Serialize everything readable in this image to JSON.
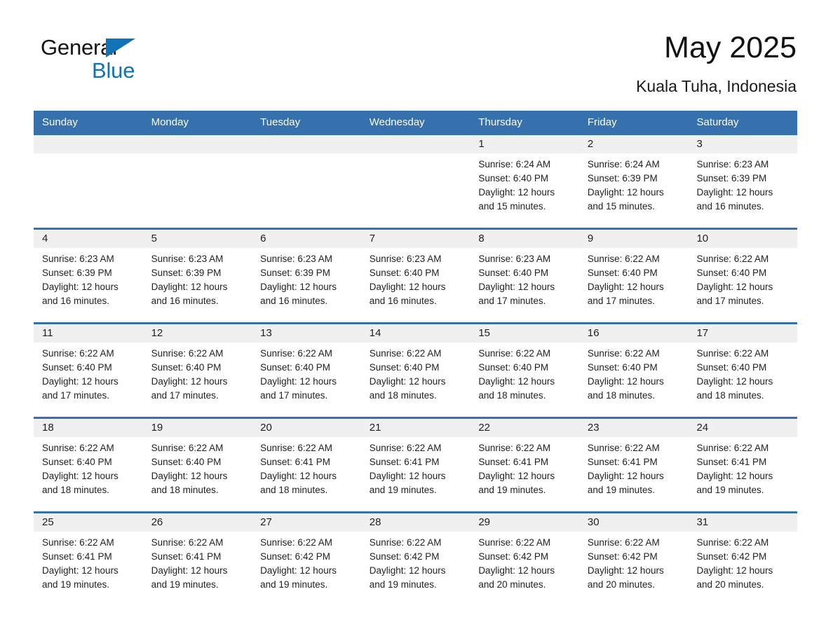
{
  "brand": {
    "name_part1": "General",
    "name_part2": "Blue",
    "triangle_color": "#1272b6"
  },
  "header": {
    "title": "May 2025",
    "subtitle": "Kuala Tuha, Indonesia"
  },
  "colors": {
    "header_blue": "#3771ad",
    "day_band_gray": "#f0f0f0",
    "brand_blue": "#1272b6"
  },
  "calendar": {
    "weekday_headers": [
      "Sunday",
      "Monday",
      "Tuesday",
      "Wednesday",
      "Thursday",
      "Friday",
      "Saturday"
    ],
    "weeks": [
      [
        {
          "day": "",
          "sunrise": "",
          "sunset": "",
          "daylight_line1": "",
          "daylight_line2": ""
        },
        {
          "day": "",
          "sunrise": "",
          "sunset": "",
          "daylight_line1": "",
          "daylight_line2": ""
        },
        {
          "day": "",
          "sunrise": "",
          "sunset": "",
          "daylight_line1": "",
          "daylight_line2": ""
        },
        {
          "day": "",
          "sunrise": "",
          "sunset": "",
          "daylight_line1": "",
          "daylight_line2": ""
        },
        {
          "day": "1",
          "sunrise": "Sunrise: 6:24 AM",
          "sunset": "Sunset: 6:40 PM",
          "daylight_line1": "Daylight: 12 hours",
          "daylight_line2": "and 15 minutes."
        },
        {
          "day": "2",
          "sunrise": "Sunrise: 6:24 AM",
          "sunset": "Sunset: 6:39 PM",
          "daylight_line1": "Daylight: 12 hours",
          "daylight_line2": "and 15 minutes."
        },
        {
          "day": "3",
          "sunrise": "Sunrise: 6:23 AM",
          "sunset": "Sunset: 6:39 PM",
          "daylight_line1": "Daylight: 12 hours",
          "daylight_line2": "and 16 minutes."
        }
      ],
      [
        {
          "day": "4",
          "sunrise": "Sunrise: 6:23 AM",
          "sunset": "Sunset: 6:39 PM",
          "daylight_line1": "Daylight: 12 hours",
          "daylight_line2": "and 16 minutes."
        },
        {
          "day": "5",
          "sunrise": "Sunrise: 6:23 AM",
          "sunset": "Sunset: 6:39 PM",
          "daylight_line1": "Daylight: 12 hours",
          "daylight_line2": "and 16 minutes."
        },
        {
          "day": "6",
          "sunrise": "Sunrise: 6:23 AM",
          "sunset": "Sunset: 6:39 PM",
          "daylight_line1": "Daylight: 12 hours",
          "daylight_line2": "and 16 minutes."
        },
        {
          "day": "7",
          "sunrise": "Sunrise: 6:23 AM",
          "sunset": "Sunset: 6:40 PM",
          "daylight_line1": "Daylight: 12 hours",
          "daylight_line2": "and 16 minutes."
        },
        {
          "day": "8",
          "sunrise": "Sunrise: 6:23 AM",
          "sunset": "Sunset: 6:40 PM",
          "daylight_line1": "Daylight: 12 hours",
          "daylight_line2": "and 17 minutes."
        },
        {
          "day": "9",
          "sunrise": "Sunrise: 6:22 AM",
          "sunset": "Sunset: 6:40 PM",
          "daylight_line1": "Daylight: 12 hours",
          "daylight_line2": "and 17 minutes."
        },
        {
          "day": "10",
          "sunrise": "Sunrise: 6:22 AM",
          "sunset": "Sunset: 6:40 PM",
          "daylight_line1": "Daylight: 12 hours",
          "daylight_line2": "and 17 minutes."
        }
      ],
      [
        {
          "day": "11",
          "sunrise": "Sunrise: 6:22 AM",
          "sunset": "Sunset: 6:40 PM",
          "daylight_line1": "Daylight: 12 hours",
          "daylight_line2": "and 17 minutes."
        },
        {
          "day": "12",
          "sunrise": "Sunrise: 6:22 AM",
          "sunset": "Sunset: 6:40 PM",
          "daylight_line1": "Daylight: 12 hours",
          "daylight_line2": "and 17 minutes."
        },
        {
          "day": "13",
          "sunrise": "Sunrise: 6:22 AM",
          "sunset": "Sunset: 6:40 PM",
          "daylight_line1": "Daylight: 12 hours",
          "daylight_line2": "and 17 minutes."
        },
        {
          "day": "14",
          "sunrise": "Sunrise: 6:22 AM",
          "sunset": "Sunset: 6:40 PM",
          "daylight_line1": "Daylight: 12 hours",
          "daylight_line2": "and 18 minutes."
        },
        {
          "day": "15",
          "sunrise": "Sunrise: 6:22 AM",
          "sunset": "Sunset: 6:40 PM",
          "daylight_line1": "Daylight: 12 hours",
          "daylight_line2": "and 18 minutes."
        },
        {
          "day": "16",
          "sunrise": "Sunrise: 6:22 AM",
          "sunset": "Sunset: 6:40 PM",
          "daylight_line1": "Daylight: 12 hours",
          "daylight_line2": "and 18 minutes."
        },
        {
          "day": "17",
          "sunrise": "Sunrise: 6:22 AM",
          "sunset": "Sunset: 6:40 PM",
          "daylight_line1": "Daylight: 12 hours",
          "daylight_line2": "and 18 minutes."
        }
      ],
      [
        {
          "day": "18",
          "sunrise": "Sunrise: 6:22 AM",
          "sunset": "Sunset: 6:40 PM",
          "daylight_line1": "Daylight: 12 hours",
          "daylight_line2": "and 18 minutes."
        },
        {
          "day": "19",
          "sunrise": "Sunrise: 6:22 AM",
          "sunset": "Sunset: 6:40 PM",
          "daylight_line1": "Daylight: 12 hours",
          "daylight_line2": "and 18 minutes."
        },
        {
          "day": "20",
          "sunrise": "Sunrise: 6:22 AM",
          "sunset": "Sunset: 6:41 PM",
          "daylight_line1": "Daylight: 12 hours",
          "daylight_line2": "and 18 minutes."
        },
        {
          "day": "21",
          "sunrise": "Sunrise: 6:22 AM",
          "sunset": "Sunset: 6:41 PM",
          "daylight_line1": "Daylight: 12 hours",
          "daylight_line2": "and 19 minutes."
        },
        {
          "day": "22",
          "sunrise": "Sunrise: 6:22 AM",
          "sunset": "Sunset: 6:41 PM",
          "daylight_line1": "Daylight: 12 hours",
          "daylight_line2": "and 19 minutes."
        },
        {
          "day": "23",
          "sunrise": "Sunrise: 6:22 AM",
          "sunset": "Sunset: 6:41 PM",
          "daylight_line1": "Daylight: 12 hours",
          "daylight_line2": "and 19 minutes."
        },
        {
          "day": "24",
          "sunrise": "Sunrise: 6:22 AM",
          "sunset": "Sunset: 6:41 PM",
          "daylight_line1": "Daylight: 12 hours",
          "daylight_line2": "and 19 minutes."
        }
      ],
      [
        {
          "day": "25",
          "sunrise": "Sunrise: 6:22 AM",
          "sunset": "Sunset: 6:41 PM",
          "daylight_line1": "Daylight: 12 hours",
          "daylight_line2": "and 19 minutes."
        },
        {
          "day": "26",
          "sunrise": "Sunrise: 6:22 AM",
          "sunset": "Sunset: 6:41 PM",
          "daylight_line1": "Daylight: 12 hours",
          "daylight_line2": "and 19 minutes."
        },
        {
          "day": "27",
          "sunrise": "Sunrise: 6:22 AM",
          "sunset": "Sunset: 6:42 PM",
          "daylight_line1": "Daylight: 12 hours",
          "daylight_line2": "and 19 minutes."
        },
        {
          "day": "28",
          "sunrise": "Sunrise: 6:22 AM",
          "sunset": "Sunset: 6:42 PM",
          "daylight_line1": "Daylight: 12 hours",
          "daylight_line2": "and 19 minutes."
        },
        {
          "day": "29",
          "sunrise": "Sunrise: 6:22 AM",
          "sunset": "Sunset: 6:42 PM",
          "daylight_line1": "Daylight: 12 hours",
          "daylight_line2": "and 20 minutes."
        },
        {
          "day": "30",
          "sunrise": "Sunrise: 6:22 AM",
          "sunset": "Sunset: 6:42 PM",
          "daylight_line1": "Daylight: 12 hours",
          "daylight_line2": "and 20 minutes."
        },
        {
          "day": "31",
          "sunrise": "Sunrise: 6:22 AM",
          "sunset": "Sunset: 6:42 PM",
          "daylight_line1": "Daylight: 12 hours",
          "daylight_line2": "and 20 minutes."
        }
      ]
    ]
  }
}
